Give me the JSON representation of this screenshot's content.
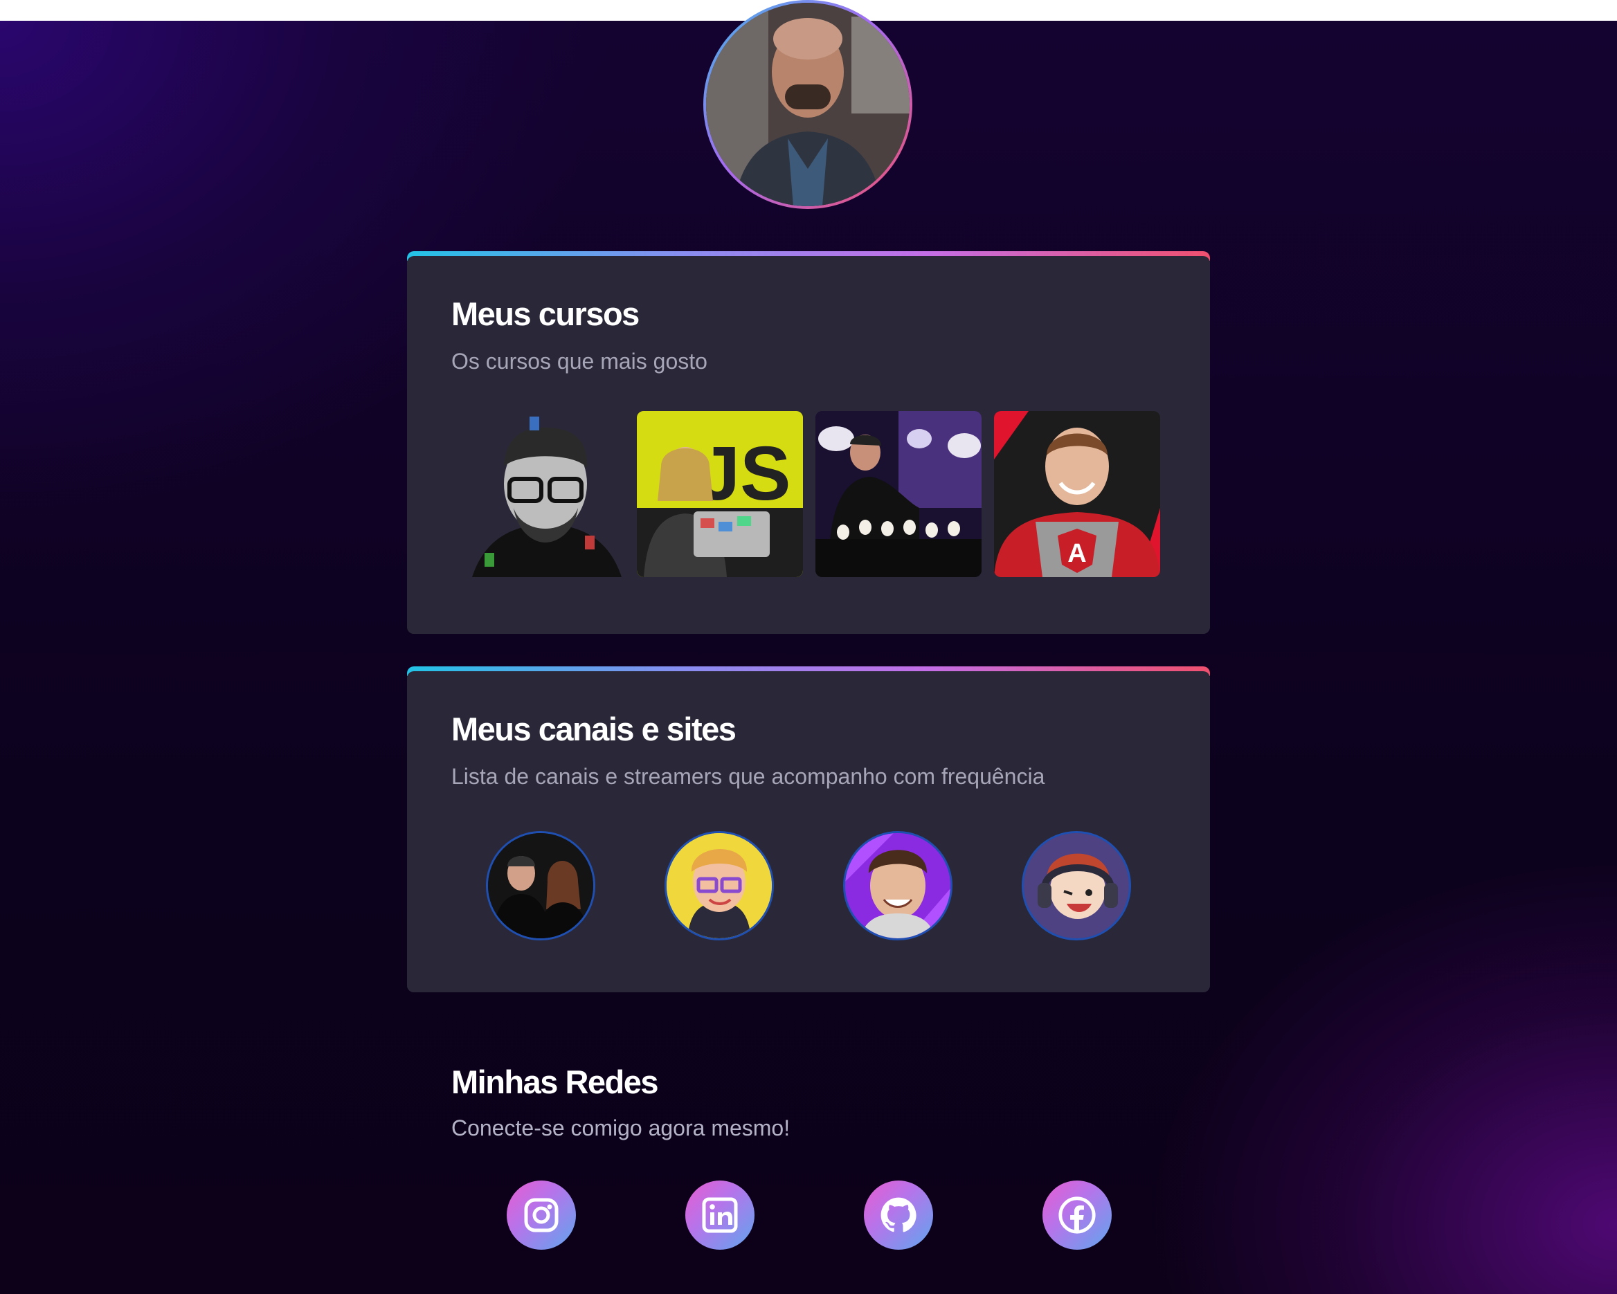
{
  "profile": {
    "avatar_icon": "profile-photo"
  },
  "courses": {
    "title": "Meus cursos",
    "subtitle": "Os cursos que mais gosto",
    "items": [
      {
        "icon": "course-instructor-photo-1"
      },
      {
        "icon": "course-javascript-photo",
        "badge": "JS"
      },
      {
        "icon": "course-instructor-photo-3"
      },
      {
        "icon": "course-angular-photo",
        "badge": "A"
      }
    ]
  },
  "channels": {
    "title": "Meus canais e sites",
    "subtitle": "Lista de canais e streamers que acompanho com frequência",
    "items": [
      {
        "icon": "channel-avatar-1"
      },
      {
        "icon": "channel-avatar-2"
      },
      {
        "icon": "channel-avatar-3"
      },
      {
        "icon": "channel-avatar-4"
      }
    ]
  },
  "social": {
    "title": "Minhas Redes",
    "subtitle": "Conecte-se comigo agora mesmo!",
    "items": [
      {
        "icon": "instagram-icon"
      },
      {
        "icon": "linkedin-icon"
      },
      {
        "icon": "github-icon"
      },
      {
        "icon": "facebook-icon"
      }
    ]
  },
  "colors": {
    "card_bg": "#2a2838",
    "accent_gradient": [
      "#23c3e6",
      "#8a8cf0",
      "#c46ee6",
      "#f0506e"
    ],
    "social_gradient": [
      "#e95bcf",
      "#b873ea",
      "#5fa6ee"
    ]
  }
}
